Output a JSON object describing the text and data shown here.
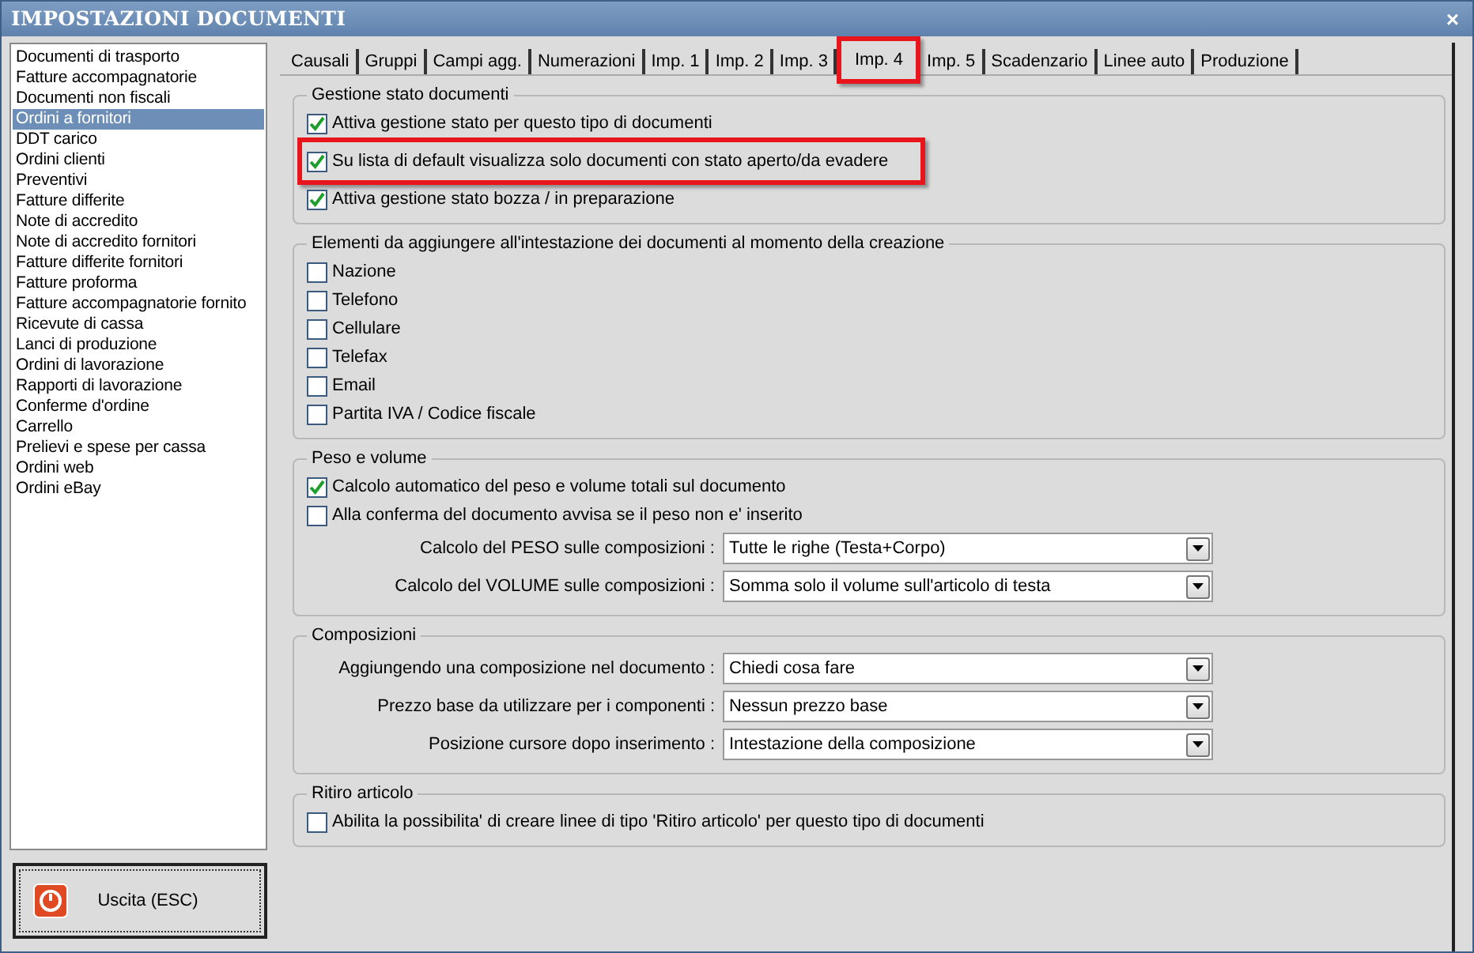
{
  "window": {
    "title": "IMPOSTAZIONI DOCUMENTI",
    "close": "×"
  },
  "sidebar": {
    "items": [
      {
        "label": "Documenti di trasporto",
        "selected": false
      },
      {
        "label": "Fatture accompagnatorie",
        "selected": false
      },
      {
        "label": "Documenti non fiscali",
        "selected": false
      },
      {
        "label": "Ordini a fornitori",
        "selected": true
      },
      {
        "label": "DDT carico",
        "selected": false
      },
      {
        "label": "Ordini clienti",
        "selected": false
      },
      {
        "label": "Preventivi",
        "selected": false
      },
      {
        "label": "Fatture differite",
        "selected": false
      },
      {
        "label": "Note di accredito",
        "selected": false
      },
      {
        "label": "Note di accredito fornitori",
        "selected": false
      },
      {
        "label": "Fatture differite fornitori",
        "selected": false
      },
      {
        "label": "Fatture proforma",
        "selected": false
      },
      {
        "label": "Fatture accompagnatorie fornito",
        "selected": false
      },
      {
        "label": "Ricevute di cassa",
        "selected": false
      },
      {
        "label": "Lanci di produzione",
        "selected": false
      },
      {
        "label": "Ordini di lavorazione",
        "selected": false
      },
      {
        "label": "Rapporti di lavorazione",
        "selected": false
      },
      {
        "label": "Conferme d'ordine",
        "selected": false
      },
      {
        "label": "Carrello",
        "selected": false
      },
      {
        "label": "Prelievi e spese per cassa",
        "selected": false
      },
      {
        "label": "Ordini web",
        "selected": false
      },
      {
        "label": "Ordini eBay",
        "selected": false
      }
    ]
  },
  "exit_button": {
    "label": "Uscita (ESC)"
  },
  "tabs": [
    {
      "label": "Causali",
      "selected": false,
      "highlighted": false
    },
    {
      "label": "Gruppi",
      "selected": false,
      "highlighted": false
    },
    {
      "label": "Campi agg.",
      "selected": false,
      "highlighted": false
    },
    {
      "label": "Numerazioni",
      "selected": false,
      "highlighted": false
    },
    {
      "label": "Imp. 1",
      "selected": false,
      "highlighted": false
    },
    {
      "label": "Imp. 2",
      "selected": false,
      "highlighted": false
    },
    {
      "label": "Imp. 3",
      "selected": false,
      "highlighted": false
    },
    {
      "label": "Imp. 4",
      "selected": true,
      "highlighted": true
    },
    {
      "label": "Imp. 5",
      "selected": false,
      "highlighted": false
    },
    {
      "label": "Scadenzario",
      "selected": false,
      "highlighted": false
    },
    {
      "label": "Linee auto",
      "selected": false,
      "highlighted": false
    },
    {
      "label": "Produzione",
      "selected": false,
      "highlighted": false
    }
  ],
  "groups": [
    {
      "title": "Gestione stato documenti",
      "items": [
        {
          "kind": "checkbox",
          "label": "Attiva gestione stato per questo tipo di documenti",
          "checked": true,
          "highlighted": false
        },
        {
          "kind": "checkbox",
          "label": "Su lista di default visualizza solo documenti con stato aperto/da evadere",
          "checked": true,
          "highlighted": true
        },
        {
          "kind": "checkbox",
          "label": "Attiva gestione stato bozza / in preparazione",
          "checked": true,
          "highlighted": false
        }
      ]
    },
    {
      "title": "Elementi da aggiungere all'intestazione dei documenti al momento della creazione",
      "items": [
        {
          "kind": "checkbox",
          "label": "Nazione",
          "checked": false,
          "highlighted": false
        },
        {
          "kind": "checkbox",
          "label": "Telefono",
          "checked": false,
          "highlighted": false
        },
        {
          "kind": "checkbox",
          "label": "Cellulare",
          "checked": false,
          "highlighted": false
        },
        {
          "kind": "checkbox",
          "label": "Telefax",
          "checked": false,
          "highlighted": false
        },
        {
          "kind": "checkbox",
          "label": "Email",
          "checked": false,
          "highlighted": false
        },
        {
          "kind": "checkbox",
          "label": "Partita IVA / Codice fiscale",
          "checked": false,
          "highlighted": false
        }
      ]
    },
    {
      "title": "Peso e volume",
      "items": [
        {
          "kind": "checkbox",
          "label": "Calcolo automatico del peso e volume totali sul documento",
          "checked": true,
          "highlighted": false
        },
        {
          "kind": "checkbox",
          "label": "Alla conferma del documento avvisa se il peso non e' inserito",
          "checked": false,
          "highlighted": false
        },
        {
          "kind": "select",
          "label": "Calcolo del PESO sulle composizioni :",
          "value": "Tutte le righe (Testa+Corpo)"
        },
        {
          "kind": "select",
          "label": "Calcolo del VOLUME sulle composizioni :",
          "value": "Somma solo il volume sull'articolo di testa"
        }
      ]
    },
    {
      "title": "Composizioni",
      "items": [
        {
          "kind": "select",
          "label": "Aggiungendo una composizione nel documento :",
          "value": "Chiedi cosa fare"
        },
        {
          "kind": "select",
          "label": "Prezzo base da utilizzare per i componenti :",
          "value": "Nessun prezzo base"
        },
        {
          "kind": "select",
          "label": "Posizione cursore dopo inserimento :",
          "value": "Intestazione della composizione"
        }
      ]
    },
    {
      "title": "Ritiro articolo",
      "items": [
        {
          "kind": "checkbox",
          "label": "Abilita la possibilita' di creare linee di tipo 'Ritiro articolo' per questo tipo di documenti",
          "checked": false,
          "highlighted": false
        }
      ]
    }
  ]
}
